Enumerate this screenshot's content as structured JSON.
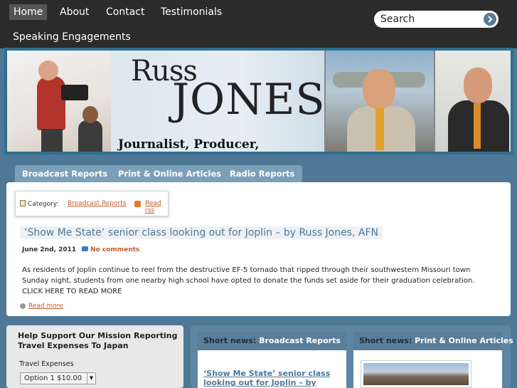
{
  "nav": {
    "items": [
      {
        "label": "Home",
        "active": true
      },
      {
        "label": "About",
        "active": false
      },
      {
        "label": "Contact",
        "active": false
      },
      {
        "label": "Testimonials",
        "active": false
      },
      {
        "label": "Speaking Engagements",
        "active": false
      }
    ],
    "search_placeholder": "Search",
    "search_icon": "arrow-right-icon"
  },
  "header": {
    "logo_first": "Russ",
    "logo_last": "JONES",
    "tagline": "Journalist, Producer, Correspondent"
  },
  "tabs": [
    "Broadcast Reports",
    "Print & Online Articles",
    "Radio Reports"
  ],
  "post": {
    "category_label": "Category:",
    "category_link": "Broadcast Reports",
    "rss_link": "Read rss",
    "title": "‘Show Me State’ senior class looking out for Joplin – by Russ Jones, AFN",
    "date": "June 2nd, 2011",
    "comments": "No comments",
    "excerpt": "As residents of Joplin continue to reel from the destructive EF-5 tornado that ripped through their southwestern Missouri town Sunday night, students from one nearby high school have opted to donate the funds set aside for their graduation celebration. CLICK HERE TO READ MORE",
    "read_more": "Read more"
  },
  "support": {
    "title": "Help Support Our Mission Reporting Travel Expenses To Japan",
    "label": "Travel Expenses",
    "selected": "Option 1 $10.00"
  },
  "short_news": [
    {
      "prefix": "Short news:",
      "section": "Broadcast Reports",
      "link": "‘Show Me State’ senior class looking out for Joplin – by Russ"
    },
    {
      "prefix": "Short news:",
      "section": "Print & Online Articles"
    }
  ],
  "colors": {
    "page_bg": "#4f7896",
    "topbar": "#2b2b2b",
    "tab": "#7a9fb9",
    "link_accent": "#c25a2a"
  }
}
